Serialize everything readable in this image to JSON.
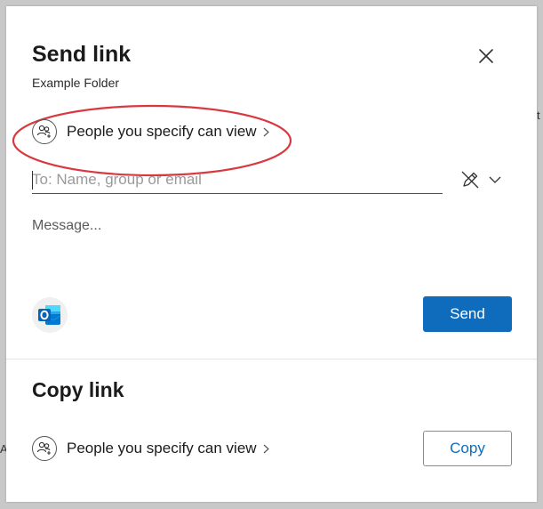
{
  "background_edge": {
    "right_char": "t",
    "left_char": "A"
  },
  "send_link": {
    "title": "Send link",
    "subtitle": "Example Folder",
    "permission_label": "People you specify can view",
    "to_placeholder": "To: Name, group or email",
    "message_placeholder": "Message...",
    "send_label": "Send"
  },
  "copy_link": {
    "title": "Copy link",
    "permission_label": "People you specify can view",
    "copy_label": "Copy"
  },
  "icons": {
    "close": "close-icon",
    "people": "people-add-icon",
    "chevron_right": "chevron-right-icon",
    "pen_off": "pen-off-icon",
    "chevron_down": "chevron-down-icon",
    "outlook": "outlook-icon"
  },
  "colors": {
    "accent": "#0f6cbd",
    "highlight_ellipse": "#d9383f"
  }
}
